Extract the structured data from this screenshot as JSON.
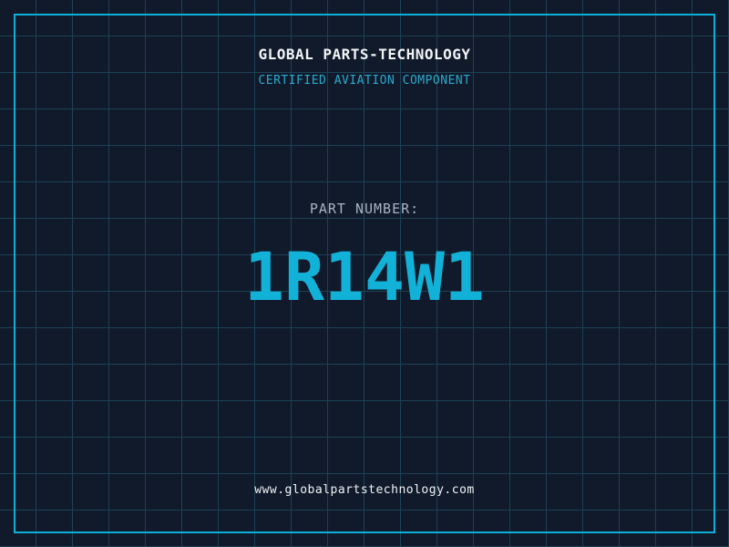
{
  "header": {
    "title": "GLOBAL PARTS-TECHNOLOGY",
    "subtitle": "CERTIFIED AVIATION COMPONENT"
  },
  "part": {
    "label": "PART NUMBER:",
    "number": "1R14W1"
  },
  "footer": {
    "website": "www.globalpartstechnology.com"
  },
  "colors": {
    "background": "#101a2b",
    "grid_line": "#1c4254",
    "frame_border": "#0cb0d8",
    "title_text": "#f2f4f6",
    "subtitle_text": "#2aa9cd",
    "part_label_text": "#a9b3be",
    "part_number_text": "#12b2d8"
  }
}
